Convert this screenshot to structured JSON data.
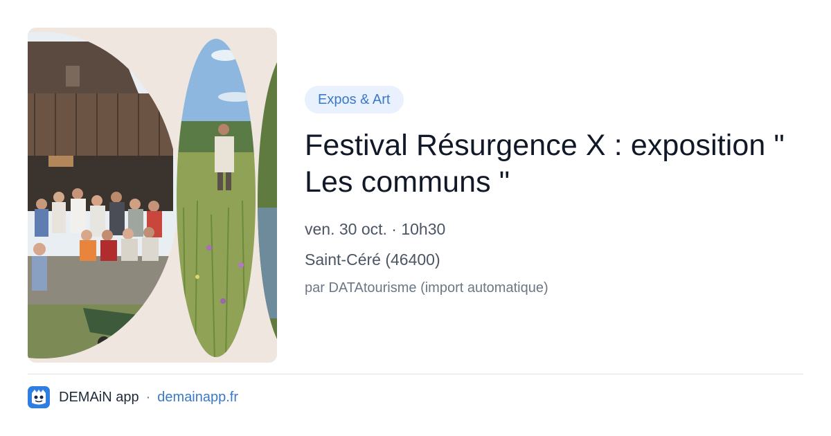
{
  "event": {
    "category": "Expos & Art",
    "title": "Festival Résurgence X : exposition \" Les communs \"",
    "date": "ven. 30 oct. · 10h30",
    "location": "Saint-Céré (46400)",
    "source": "par DATAtourisme (import automatique)",
    "image_description": "photo-collage"
  },
  "footer": {
    "app_name": "DEMAiN app",
    "separator": "·",
    "link": "demainapp.fr",
    "logo_icon": "demain-logo-icon"
  },
  "colors": {
    "badge_bg": "#e8f1fd",
    "badge_text": "#3a78c9",
    "link": "#3a78c9",
    "image_bg": "#efe6df",
    "logo": "#2f7de1"
  }
}
